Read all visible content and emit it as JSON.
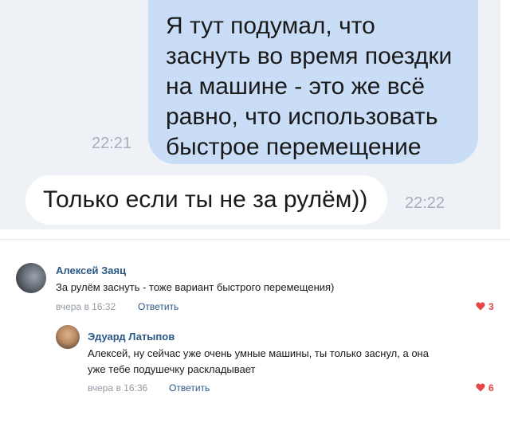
{
  "chat": {
    "outgoing": {
      "lines": [
        "Я тут подумал, что",
        "заснуть во время поездки",
        "на машине - это же всё",
        "равно, что использовать",
        "быстрое перемещение"
      ],
      "time": "22:21"
    },
    "incoming": {
      "text": "Только если ты не за рулём))",
      "time": "22:22"
    }
  },
  "comments": [
    {
      "author": "Алексей Заяц",
      "text": "За рулём заснуть - тоже вариант быстрого перемещения)",
      "date": "вчера в 16:32",
      "reply_label": "Ответить",
      "likes": "3"
    },
    {
      "author": "Эдуард Латыпов",
      "text_lines": [
        "Алексей, ну сейчас уже очень умные машины, ты только заснул, а она",
        "уже тебе подушечку раскладывает"
      ],
      "date": "вчера в 16:36",
      "reply_label": "Ответить",
      "likes": "6"
    }
  ],
  "colors": {
    "chat_background": "#eef1f6",
    "outgoing_bubble": "#c9ddf7",
    "incoming_bubble": "#ffffff",
    "link": "#2a5885",
    "like": "#e64646"
  },
  "icons": {
    "like": "heart-icon"
  }
}
